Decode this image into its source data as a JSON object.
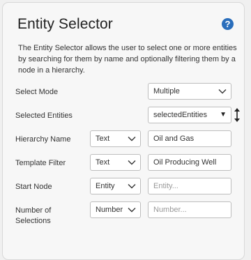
{
  "title": "Entity Selector",
  "description": "The Entity Selector allows the user to select one or more entities by searching for them by name and optionally filtering them by a node in a hierarchy.",
  "help_icon": "?",
  "fields": {
    "select_mode": {
      "label": "Select Mode",
      "value": "Multiple"
    },
    "selected_entities": {
      "label": "Selected Entities",
      "value": "selectedEntities"
    },
    "hierarchy_name": {
      "label": "Hierarchy Name",
      "type": "Text",
      "value": "Oil and Gas"
    },
    "template_filter": {
      "label": "Template Filter",
      "type": "Text",
      "value": "Oil Producing Well"
    },
    "start_node": {
      "label": "Start Node",
      "type": "Entity",
      "placeholder": "Entity..."
    },
    "number_of_selections": {
      "label_line1": "Number of",
      "label_line2": "Selections",
      "type": "Number",
      "placeholder": "Number..."
    }
  },
  "icons": [
    "help-icon",
    "chevron-down-icon",
    "caret-down-icon",
    "resize-vertical-icon"
  ],
  "colors": {
    "help": "#2a6ebc",
    "panel": "#f7f7f7",
    "border": "#bdbdbd"
  }
}
